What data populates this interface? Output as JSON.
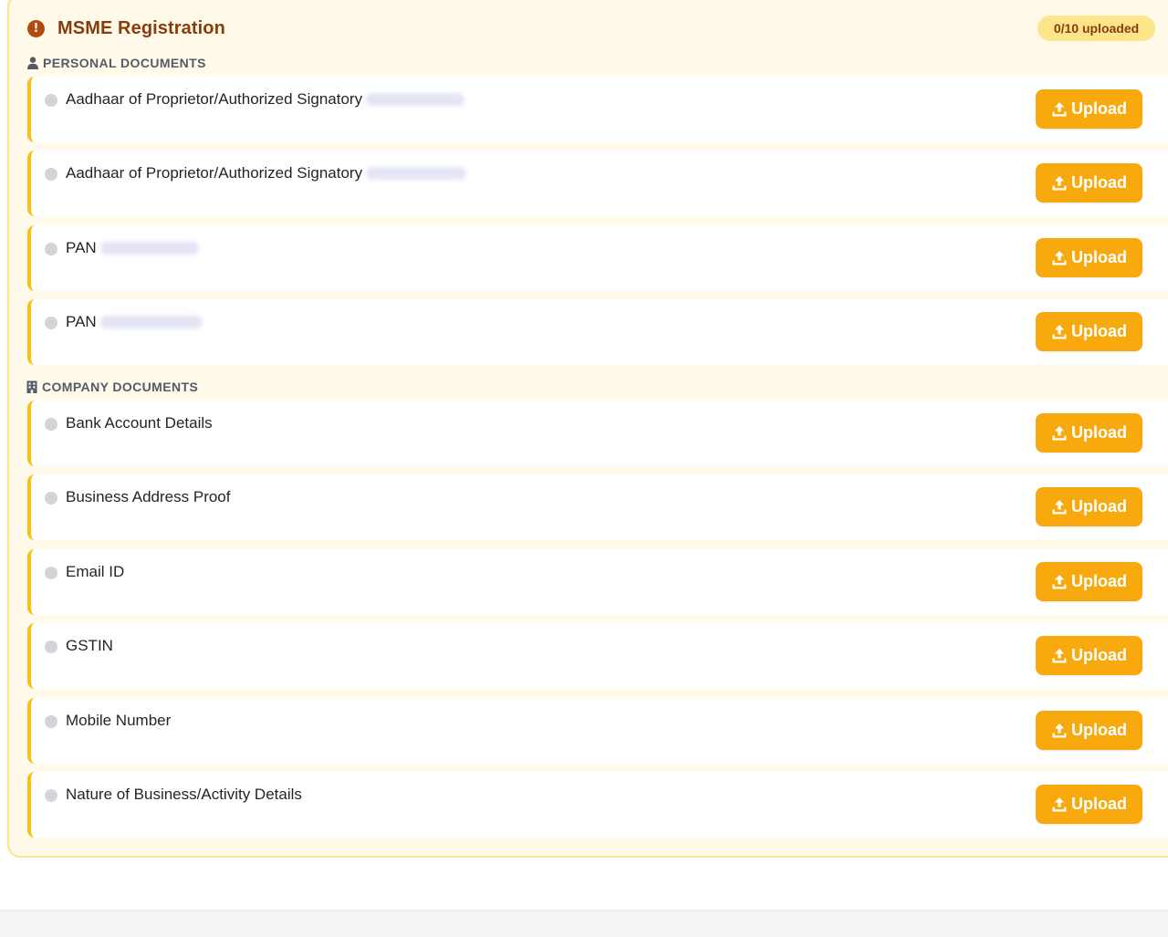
{
  "header": {
    "title": "MSME Registration",
    "badge": "0/10 uploaded",
    "alert_icon": "alert-circle-icon"
  },
  "sections": {
    "personal": {
      "heading": "PERSONAL DOCUMENTS",
      "icon": "user-icon"
    },
    "company": {
      "heading": "COMPANY DOCUMENTS",
      "icon": "building-icon"
    }
  },
  "upload_label": "Upload",
  "rows": [
    {
      "label": "Aadhaar of Proprietor/Authorized Signatory",
      "redacted": true
    },
    {
      "label": "Aadhaar of Proprietor/Authorized Signatory",
      "redacted": true
    },
    {
      "label": "PAN",
      "redacted": true
    },
    {
      "label": "PAN",
      "redacted": true
    },
    {
      "label": "Bank Account Details",
      "redacted": false
    },
    {
      "label": "Business Address Proof",
      "redacted": false
    },
    {
      "label": "Email ID",
      "redacted": false
    },
    {
      "label": "GSTIN",
      "redacted": false
    },
    {
      "label": "Mobile Number",
      "redacted": false
    },
    {
      "label": "Nature of Business/Activity Details",
      "redacted": false
    }
  ],
  "colors": {
    "accent": "#f7a90e",
    "card_bg": "#fffae9",
    "card_border": "#fae58a",
    "title": "#8a3b0c",
    "row_accent": "#f9c018"
  }
}
